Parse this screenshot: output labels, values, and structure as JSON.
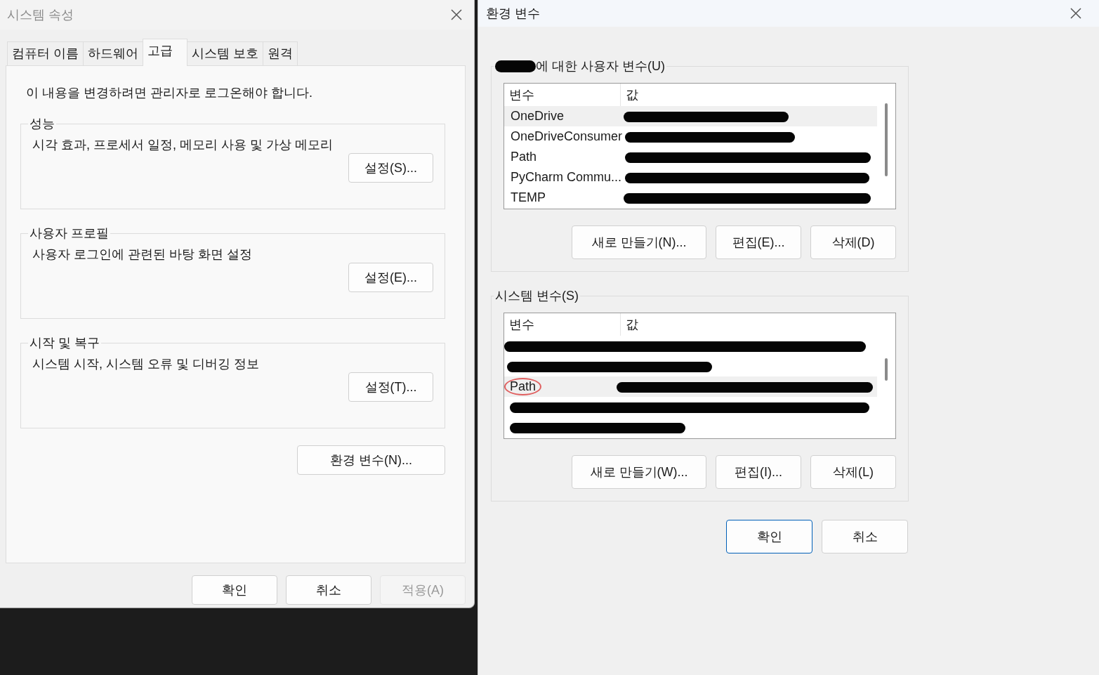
{
  "left_window": {
    "title": "시스템 속성",
    "tabs": [
      {
        "label": "컴퓨터 이름",
        "selected": false
      },
      {
        "label": "하드웨어",
        "selected": false
      },
      {
        "label": "고급",
        "selected": true
      },
      {
        "label": "시스템 보호",
        "selected": false
      },
      {
        "label": "원격",
        "selected": false
      }
    ],
    "notice": "이 내용을 변경하려면 관리자로 로그온해야 합니다.",
    "groups": [
      {
        "title": "성능",
        "description": "시각 효과, 프로세서 일정, 메모리 사용 및 가상 메모리",
        "button": "설정(S)..."
      },
      {
        "title": "사용자 프로필",
        "description": "사용자 로그인에 관련된 바탕 화면 설정",
        "button": "설정(E)..."
      },
      {
        "title": "시작 및 복구",
        "description": "시스템 시작, 시스템 오류 및 디버깅 정보",
        "button": "설정(T)..."
      }
    ],
    "env_button": "환경 변수(N)...",
    "buttons": [
      {
        "label": "확인",
        "disabled": false
      },
      {
        "label": "취소",
        "disabled": false
      },
      {
        "label": "적용(A)",
        "disabled": true
      }
    ]
  },
  "right_window": {
    "title": "환경 변수",
    "sections": [
      {
        "title": "에 대한 사용자 변수(U)",
        "title_redacted": true,
        "columns": [
          "변수",
          "값"
        ],
        "rows": [
          {
            "kind": "named",
            "name": "OneDrive",
            "selected": true,
            "circled": false
          },
          {
            "kind": "named",
            "name": "OneDriveConsumer",
            "selected": false,
            "circled": false
          },
          {
            "kind": "named",
            "name": "Path",
            "selected": false,
            "circled": false
          },
          {
            "kind": "named",
            "name": "PyCharm Commu...",
            "selected": false,
            "circled": false
          },
          {
            "kind": "named",
            "name": "TEMP",
            "selected": false,
            "circled": false
          }
        ],
        "buttons": [
          "새로 만들기(N)...",
          "편집(E)...",
          "삭제(D)"
        ]
      },
      {
        "title": "시스템 변수(S)",
        "title_redacted": false,
        "columns": [
          "변수",
          "값"
        ],
        "rows": [
          {
            "kind": "redacted",
            "selected": false
          },
          {
            "kind": "redacted",
            "selected": false
          },
          {
            "kind": "named",
            "name": "Path",
            "selected": true,
            "circled": true
          },
          {
            "kind": "redacted",
            "selected": false
          },
          {
            "kind": "redacted",
            "selected": false
          }
        ],
        "buttons": [
          "새로 만들기(W)...",
          "편집(I)...",
          "삭제(L)"
        ]
      }
    ],
    "buttons": [
      {
        "label": "확인",
        "default": true
      },
      {
        "label": "취소",
        "default": false
      }
    ]
  }
}
